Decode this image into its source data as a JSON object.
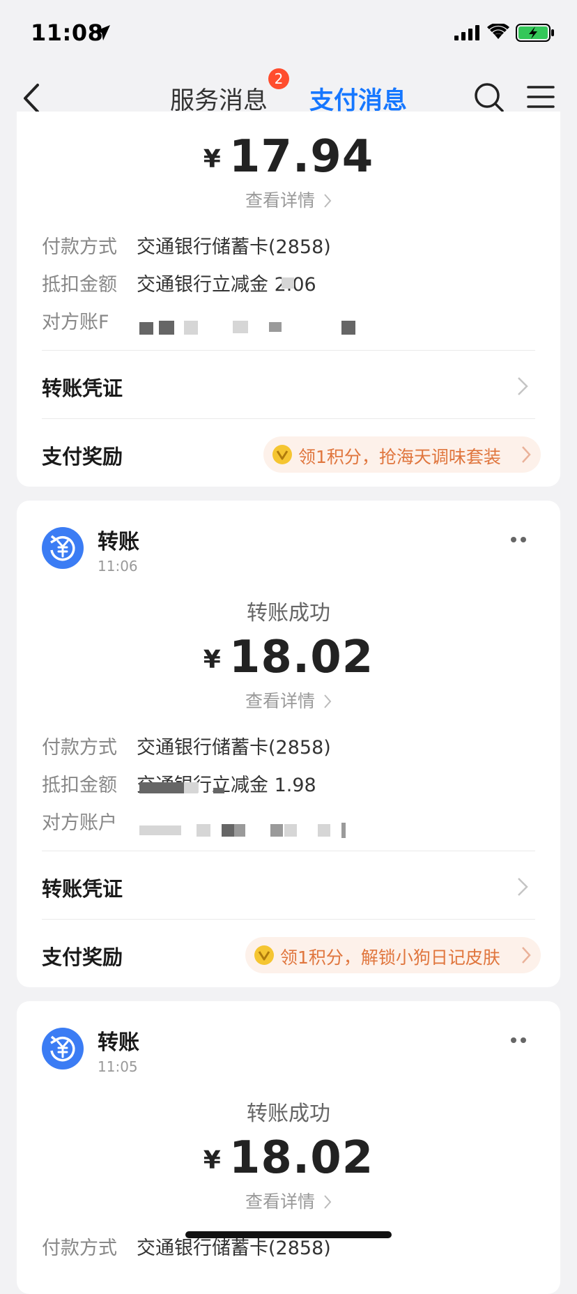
{
  "status_bar": {
    "time": "11:08"
  },
  "nav": {
    "tabs": [
      {
        "label": "服务消息",
        "badge": "2"
      },
      {
        "label": "支付消息"
      }
    ]
  },
  "labels": {
    "detail_link": "查看详情",
    "pay_method": "付款方式",
    "deduction": "抵扣金额",
    "counterparty": "对方账户",
    "voucher": "转账凭证",
    "reward": "支付奖励"
  },
  "cards": [
    {
      "amount_symbol": "¥",
      "amount": "17.94",
      "pay_method_value": "交通银行储蓄卡(2858)",
      "deduction_value": "交通银行立减金 2.06",
      "counterparty_label_partial": "对方账F",
      "reward_text": "领1积分，抢海天调味套装"
    },
    {
      "title": "转账",
      "time": "11:06",
      "status": "转账成功",
      "amount_symbol": "¥",
      "amount": "18.02",
      "pay_method_value": "交通银行储蓄卡(2858)",
      "deduction_value": "交通银行立减金 1.98",
      "reward_text": "领1积分，解锁小狗日记皮肤"
    },
    {
      "title": "转账",
      "time": "11:05",
      "status": "转账成功",
      "amount_symbol": "¥",
      "amount": "18.02",
      "pay_method_value": "交通银行储蓄卡(2858)"
    }
  ],
  "colors": {
    "accent_blue": "#1677ff",
    "badge_red": "#ff4d2e",
    "reward_orange": "#e0763e",
    "reward_bg": "#fdf1ea",
    "background": "#f2f2f4"
  }
}
